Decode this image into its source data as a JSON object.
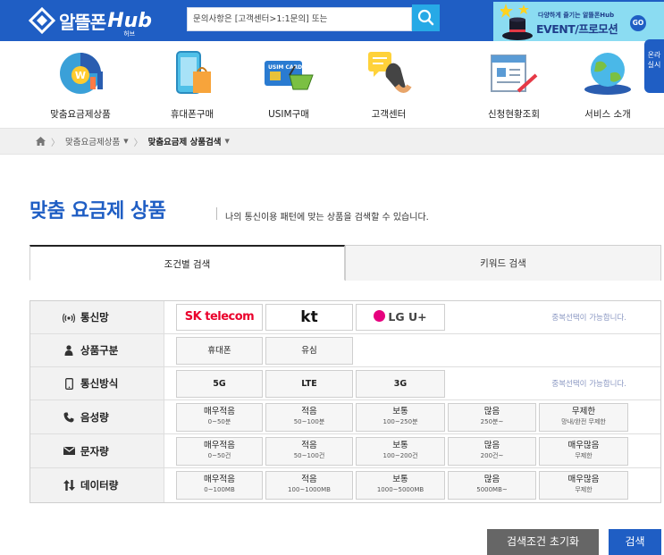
{
  "header": {
    "logo_text": "알뜰폰",
    "logo_hub": "Hub",
    "logo_sub": "허브",
    "search_placeholder": "문의사항은 [고객센터>1:1문의] 또는",
    "event_small": "다양하게 즐기는 알뜰폰Hub",
    "event_big": "EVENT/프로모션",
    "event_go": "GO"
  },
  "nav": {
    "items": [
      {
        "label": "맞춤요금제상품",
        "icon": "rate-plan-icon"
      },
      {
        "label": "휴대폰구매",
        "icon": "phone-shopping-icon"
      },
      {
        "label": "USIM구매",
        "icon": "usim-card-icon"
      },
      {
        "label": "고객센터",
        "icon": "customer-center-icon"
      },
      {
        "label": "신청현황조회",
        "icon": "application-status-icon"
      },
      {
        "label": "서비스 소개",
        "icon": "globe-icon"
      }
    ],
    "side_badge": "온라\n실시"
  },
  "breadcrumb": {
    "item1": "맞춤요금제상품",
    "item2": "맞춤요금제 상품검색"
  },
  "page": {
    "title": "맞춤 요금제 상품",
    "subtitle": "나의 통신이용 패턴에 맞는 상품을 검색할 수 있습니다."
  },
  "tabs": [
    {
      "label": "조건별 검색",
      "active": true
    },
    {
      "label": "키워드 검색",
      "active": false
    }
  ],
  "filters": {
    "carrier": {
      "label": "통신망",
      "options": [
        "SK telecom",
        "kt",
        "LG U+"
      ],
      "note": "중복선택이 가능합니다."
    },
    "product": {
      "label": "상품구분",
      "options": [
        "휴대폰",
        "유심"
      ]
    },
    "network": {
      "label": "통신방식",
      "options": [
        "5G",
        "LTE",
        "3G"
      ],
      "note": "중복선택이 가능합니다."
    },
    "voice": {
      "label": "음성량",
      "options": [
        {
          "title": "매우적음",
          "range": "0~50분"
        },
        {
          "title": "적음",
          "range": "50~100분"
        },
        {
          "title": "보통",
          "range": "100~250분"
        },
        {
          "title": "많음",
          "range": "250분~"
        },
        {
          "title": "무제한",
          "range": "망내/완전 무제한"
        }
      ]
    },
    "sms": {
      "label": "문자량",
      "options": [
        {
          "title": "매우적음",
          "range": "0~50건"
        },
        {
          "title": "적음",
          "range": "50~100건"
        },
        {
          "title": "보통",
          "range": "100~200건"
        },
        {
          "title": "많음",
          "range": "200건~"
        },
        {
          "title": "매우많음",
          "range": "무제한"
        }
      ]
    },
    "data": {
      "label": "데이터량",
      "options": [
        {
          "title": "매우적음",
          "range": "0~100MB"
        },
        {
          "title": "적음",
          "range": "100~1000MB"
        },
        {
          "title": "보통",
          "range": "1000~5000MB"
        },
        {
          "title": "많음",
          "range": "5000MB~"
        },
        {
          "title": "매우많음",
          "range": "무제한"
        }
      ]
    }
  },
  "buttons": {
    "reset": "검색조건 초기화",
    "search": "검색"
  },
  "colors": {
    "brand_blue": "#1f5ec4",
    "sk_red": "#ea002c",
    "lg_red": "#e6007e"
  }
}
